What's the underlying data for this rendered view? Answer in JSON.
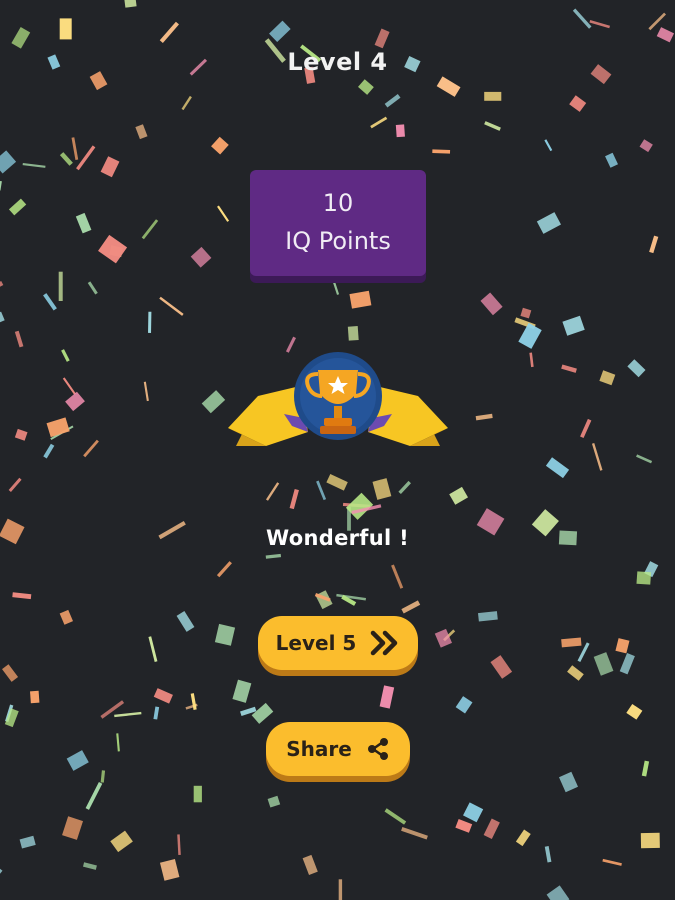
{
  "header": {
    "level_label": "Level 4"
  },
  "reward": {
    "points_value": "10",
    "points_unit": "IQ Points"
  },
  "badge": {
    "icon": "trophy-star-icon"
  },
  "result": {
    "message": "Wonderful !"
  },
  "actions": {
    "next_level_label": "Level 5",
    "next_level_icon": "double-chevron-right-icon",
    "share_label": "Share",
    "share_icon": "share-icon"
  },
  "colors": {
    "background": "#222428",
    "points_box": "#5f2a84",
    "button": "#fbbd2d",
    "ribbon": "#f7c623",
    "badge_circle": "#1f4b8a",
    "trophy": "#f5a623"
  }
}
